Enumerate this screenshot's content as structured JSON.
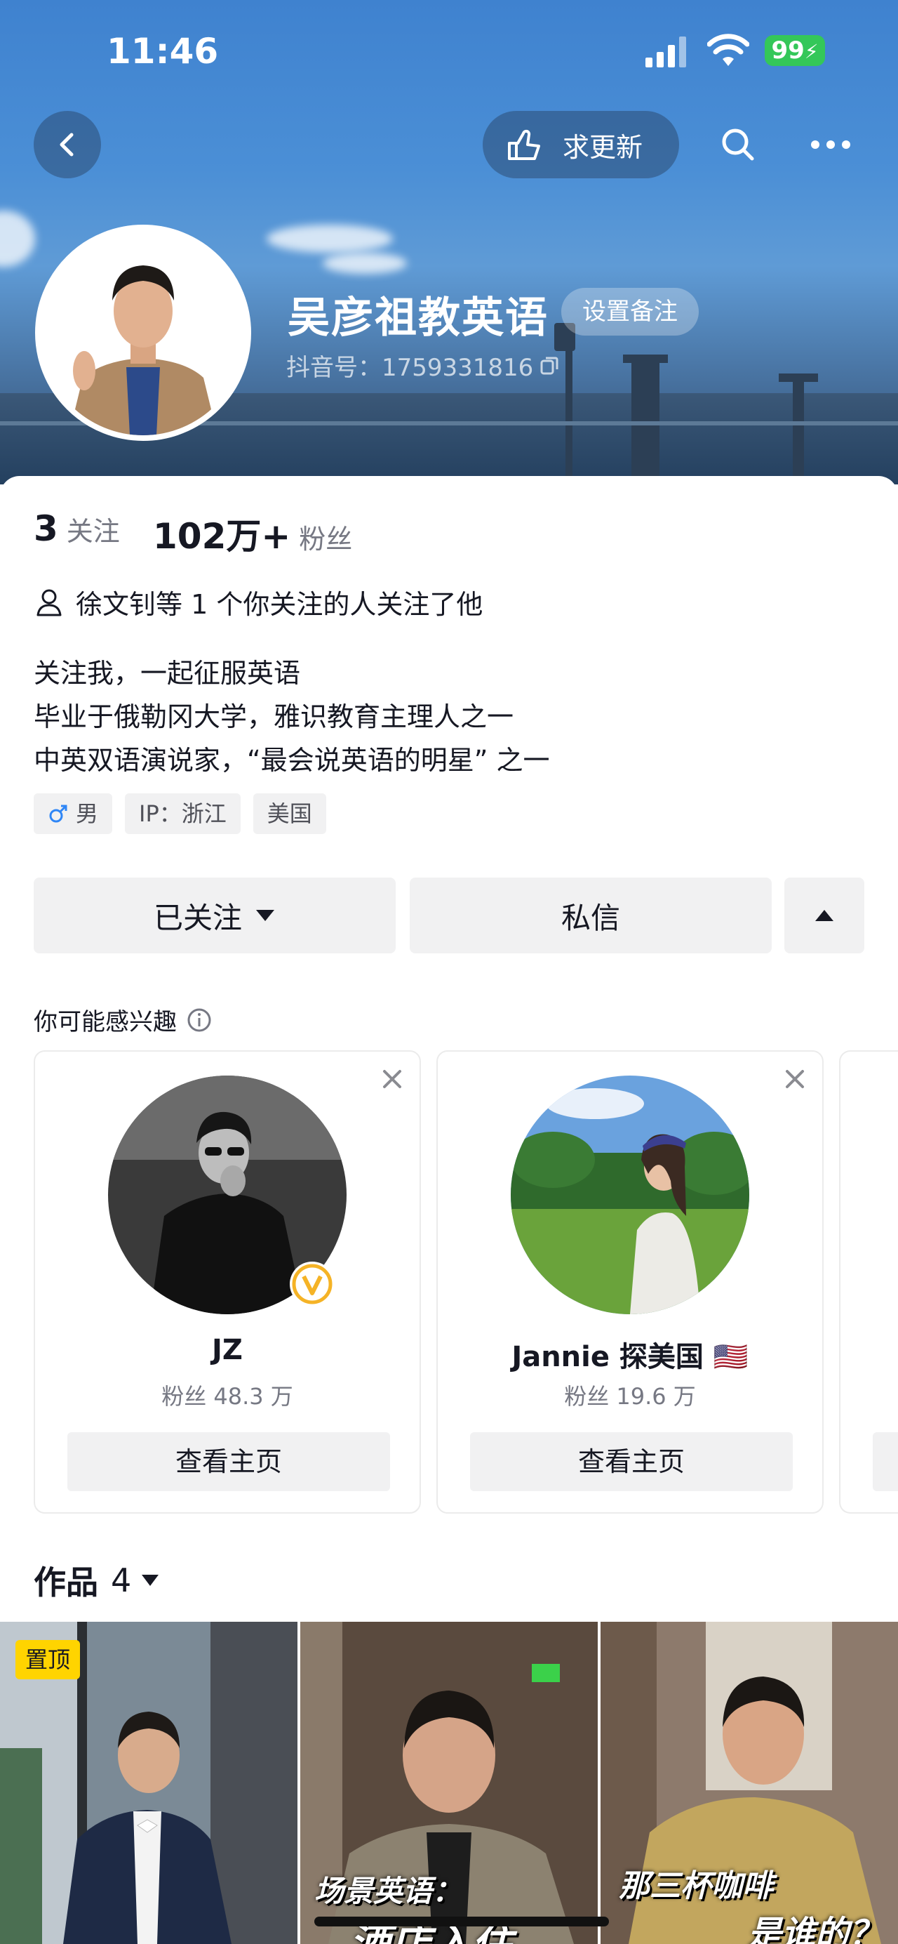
{
  "status_bar": {
    "time": "11:46",
    "battery": "99"
  },
  "nav": {
    "update_request_label": "求更新"
  },
  "profile": {
    "name": "吴彦祖教英语",
    "remark_label": "设置备注",
    "douyin_id": "抖音号：1759331816",
    "following_count": "3",
    "following_label": "关注",
    "followers_count": "102万+",
    "followers_label": "粉丝",
    "mutual_text": "徐文钊等 1 个你关注的人关注了他",
    "bio_lines": [
      "关注我，一起征服英语",
      "毕业于俄勒冈大学，雅识教育主理人之一",
      "中英双语演说家，“最会说英语的明星” 之一"
    ],
    "tags": [
      {
        "icon": "male-icon",
        "label": "男"
      },
      {
        "label": "IP：浙江"
      },
      {
        "label": "美国"
      }
    ]
  },
  "actions": {
    "following_label": "已关注",
    "message_label": "私信"
  },
  "suggestions": {
    "title": "你可能感兴趣",
    "cards": [
      {
        "name": "JZ",
        "fans": "粉丝 48.3 万",
        "button": "查看主页",
        "verified": true
      },
      {
        "name": "Jannie 探美国 🇺🇸",
        "fans": "粉丝 19.6 万",
        "button": "查看主页",
        "verified": false
      }
    ]
  },
  "works": {
    "label": "作品",
    "count": "4",
    "pinned_label": "置顶",
    "thumbnails": [
      {
        "caption": ""
      },
      {
        "caption": "场景英语：",
        "caption2": "酒店入住"
      },
      {
        "caption": "那三杯咖啡",
        "caption2": "是谁的？"
      }
    ]
  },
  "colors": {
    "accent_tag": "#ffd400",
    "battery": "#34c759",
    "verified": "#f5b326"
  }
}
